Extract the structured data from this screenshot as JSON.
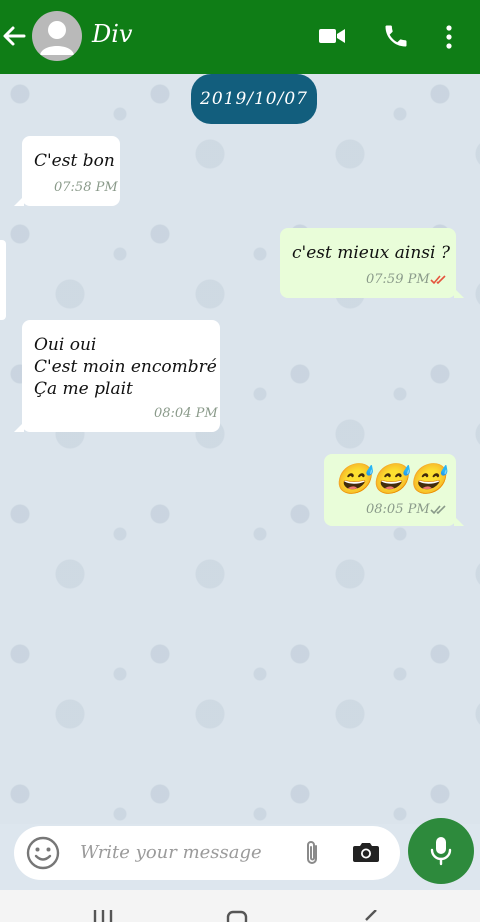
{
  "header": {
    "contact_name": "Div",
    "icons": [
      "back-arrow-icon",
      "avatar-icon",
      "video-call-icon",
      "phone-icon",
      "more-vert-icon"
    ],
    "color": "#0f7d16"
  },
  "chat": {
    "date_label": "2019/10/07",
    "messages": [
      {
        "direction": "in",
        "text": "C'est bon",
        "time": "07:58 PM"
      },
      {
        "direction": "out",
        "text": "c'est mieux ainsi ?",
        "time": "07:59 PM",
        "status": "read"
      },
      {
        "direction": "in",
        "text": "Oui oui\nC'est moin encombré\nÇa me plait",
        "time": "08:04 PM"
      },
      {
        "direction": "out",
        "text": "😅😅😅",
        "time": "08:05 PM",
        "status": "delivered"
      }
    ]
  },
  "composer": {
    "placeholder": "Write your message",
    "icons": [
      "emoji-icon",
      "attach-icon",
      "camera-icon",
      "mic-icon"
    ]
  },
  "colors": {
    "header": "#0f7d16",
    "date_badge": "#125e7d",
    "outgoing": "#e9fdd9",
    "incoming": "#ffffff",
    "mic": "#2d8a3c"
  }
}
